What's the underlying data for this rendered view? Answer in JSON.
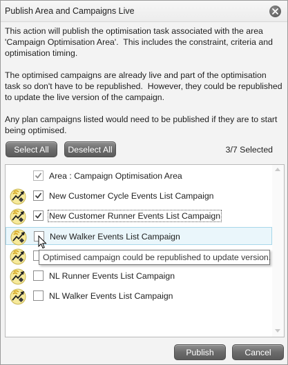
{
  "dialog": {
    "title": "Publish Area and Campaigns Live",
    "close_icon": "close-icon"
  },
  "message": {
    "paragraph1": "This action will publish the optimisation task associated with the area 'Campaign Optimisation Area'.  This includes the constraint, criteria and optimisation timing.",
    "paragraph2": "The optimised campaigns are already live and part of the optimisation task so don't have to be republished.  However, they could be republished to update the live version of the campaign.",
    "paragraph3": "Any plan campaigns listed would need to be published if they are to start being optimised."
  },
  "toolbar": {
    "select_all_label": "Select All",
    "deselect_all_label": "Deselect All",
    "selected_count": "3/7 Selected"
  },
  "list": {
    "items": [
      {
        "label": "Area : Campaign Optimisation Area",
        "checked": true,
        "has_icon": false,
        "checkbox_disabled": true,
        "icon": ""
      },
      {
        "label": "New Customer Cycle Events List Campaign",
        "checked": true,
        "has_icon": true,
        "icon": "optimised-campaign-icon"
      },
      {
        "label": "New Customer Runner Events List Campaign",
        "checked": true,
        "has_icon": true,
        "focused": true,
        "icon": "optimised-campaign-icon"
      },
      {
        "label": "New Walker Events List Campaign",
        "checked": false,
        "has_icon": true,
        "hover": true,
        "icon": "optimised-campaign-icon"
      },
      {
        "label": "",
        "checked": false,
        "has_icon": true,
        "icon": "optimised-campaign-icon"
      },
      {
        "label": "NL Runner Events List Campaign",
        "checked": false,
        "has_icon": true,
        "icon": "optimised-campaign-icon"
      },
      {
        "label": "NL Walker Events List Campaign",
        "checked": false,
        "has_icon": true,
        "icon": "optimised-campaign-icon"
      }
    ]
  },
  "tooltip": {
    "text": "Optimised campaign could be republished to update version."
  },
  "footer": {
    "publish_label": "Publish",
    "cancel_label": "Cancel"
  },
  "colors": {
    "button_gradient_top": "#8e8e8e",
    "button_gradient_bottom": "#5b5b5b",
    "hover_row": "#eaf6fb",
    "hover_row_border": "#a7d7ea",
    "checkmark": "#3c3c3c",
    "icon_bg": "#f6e99a",
    "icon_accent": "#d4a017"
  }
}
